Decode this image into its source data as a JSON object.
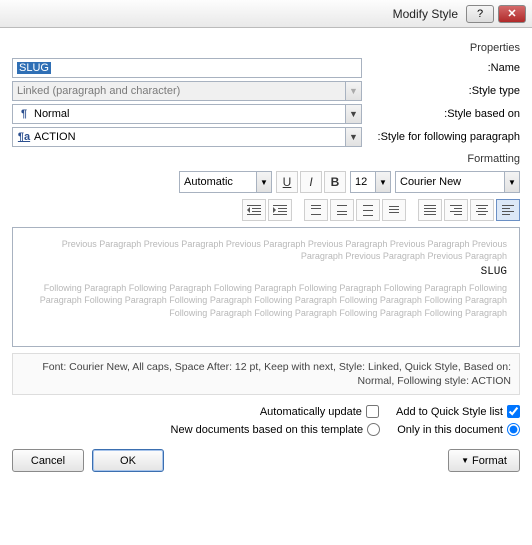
{
  "window": {
    "title": "Modify Style"
  },
  "section_properties": "Properties",
  "labels": {
    "name": "Name:",
    "style_type": "Style type:",
    "based_on": "Style based on:",
    "following": "Style for following paragraph:"
  },
  "fields": {
    "name_value": "SLUG",
    "style_type_value": "Linked (paragraph and character)",
    "based_on_value": "Normal",
    "following_value": "ACTION"
  },
  "section_formatting": "Formatting",
  "format_toolbar": {
    "font": "Courier New",
    "size": "12",
    "bold": "B",
    "italic": "I",
    "underline": "U",
    "color": "Automatic"
  },
  "preview": {
    "prev_line": "Previous Paragraph Previous Paragraph Previous Paragraph Previous Paragraph Previous Paragraph Previous Paragraph Previous Paragraph Previous Paragraph",
    "sample": "SLUG",
    "next_line": "Following Paragraph Following Paragraph Following Paragraph Following Paragraph Following Paragraph Following Paragraph Following Paragraph Following Paragraph Following Paragraph Following Paragraph Following Paragraph Following Paragraph Following Paragraph Following Paragraph Following Paragraph"
  },
  "description": "Font: Courier New, All caps, Space After: 12 pt, Keep with next, Style: Linked, Quick Style, Based on: Normal, Following style: ACTION",
  "options": {
    "add_quick": "Add to Quick Style list",
    "auto_update": "Automatically update",
    "only_doc": "Only in this document",
    "new_docs": "New documents based on this template"
  },
  "buttons": {
    "format": "Format",
    "ok": "OK",
    "cancel": "Cancel"
  }
}
